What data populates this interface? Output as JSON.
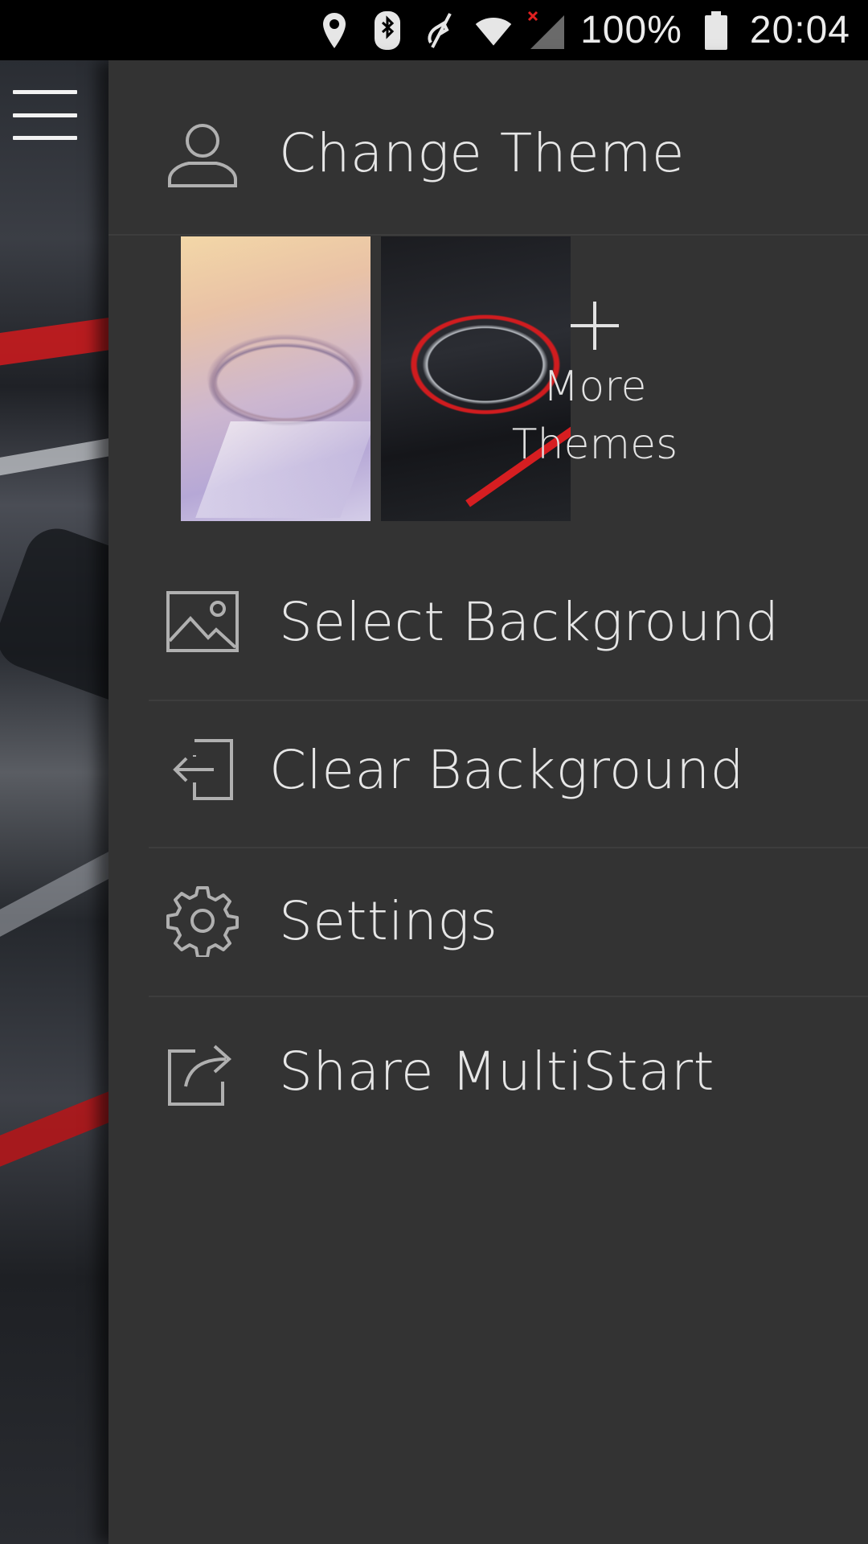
{
  "status_bar": {
    "icons": [
      "location-pin-icon",
      "bluetooth-icon",
      "vibrate-off-icon",
      "wifi-icon",
      "no-signal-icon",
      "battery-icon"
    ],
    "battery": "100%",
    "time": "20:04"
  },
  "drawer": {
    "change_theme": {
      "label": "Change Theme",
      "icon": "person-icon"
    },
    "themes": [
      {
        "name": "light-theme",
        "selected": false
      },
      {
        "name": "dark-red-theme",
        "selected": true
      }
    ],
    "more_themes": {
      "line1": "More",
      "line2": "Themes"
    },
    "items": [
      {
        "label": "Select Background",
        "icon": "image-icon"
      },
      {
        "label": "Clear Background",
        "icon": "exit-icon"
      },
      {
        "label": "Settings",
        "icon": "gear-icon"
      },
      {
        "label": "Share MultiStart",
        "icon": "share-icon"
      }
    ]
  },
  "colors": {
    "drawer_bg": "#333333",
    "text": "#e6e6e6",
    "accent_red": "#d01c1f"
  }
}
